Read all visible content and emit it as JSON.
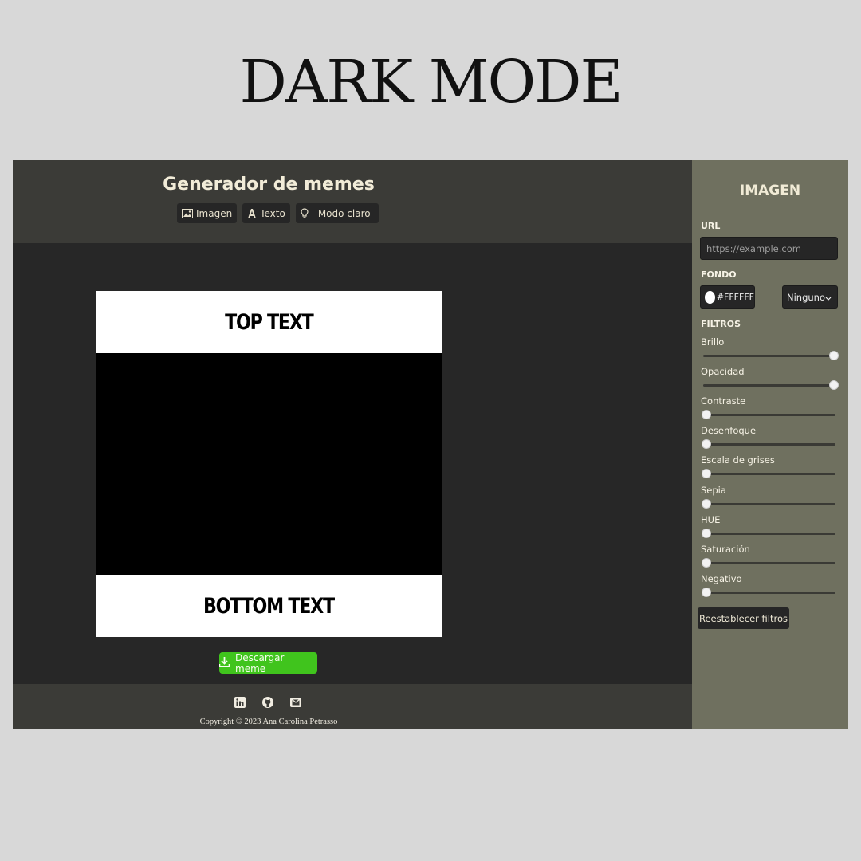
{
  "banner": {
    "title": "DARK MODE"
  },
  "header": {
    "title": "Generador de memes",
    "nav": [
      {
        "label": "Imagen",
        "icon": "image-icon"
      },
      {
        "label": "Texto",
        "icon": "text-icon"
      },
      {
        "label": "Modo claro",
        "icon": "lightbulb-icon"
      }
    ]
  },
  "meme": {
    "top_text": "TOP TEXT",
    "bottom_text": "BOTTOM TEXT",
    "download_label": "Descargar meme"
  },
  "footer": {
    "social": [
      "linkedin-icon",
      "github-icon",
      "mail-icon"
    ],
    "copyright": "Copyright © 2023 Ana Carolina Petrasso"
  },
  "panel": {
    "title": "IMAGEN",
    "url_label": "URL",
    "url_placeholder": "https://example.com",
    "background_label": "FONDO",
    "background_color": "#FFFFFF",
    "blend_mode": "Ninguno",
    "filters_label": "FILTROS",
    "filters": [
      {
        "label": "Brillo",
        "value": 1.0
      },
      {
        "label": "Opacidad",
        "value": 1.0
      },
      {
        "label": "Contraste",
        "value": 0.0
      },
      {
        "label": "Desenfoque",
        "value": 0.0
      },
      {
        "label": "Escala de grises",
        "value": 0.0
      },
      {
        "label": "Sepia",
        "value": 0.0
      },
      {
        "label": "HUE",
        "value": 0.0
      },
      {
        "label": "Saturación",
        "value": 0.0
      },
      {
        "label": "Negativo",
        "value": 0.0
      }
    ],
    "reset_label": "Reestablecer filtros"
  },
  "colors": {
    "page_bg": "#d8d8d8",
    "header_bg": "#3b3b37",
    "main_bg": "#272727",
    "panel_bg": "#6f705f",
    "download_bg": "#40c41d"
  }
}
